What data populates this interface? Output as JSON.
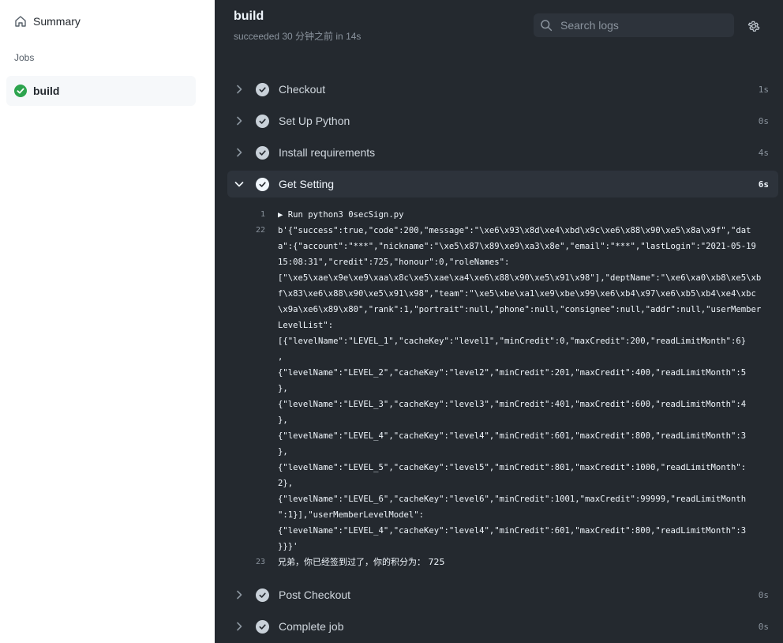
{
  "sidebar": {
    "summary_label": "Summary",
    "jobs_heading": "Jobs",
    "jobs": [
      {
        "label": "build",
        "status": "success"
      }
    ]
  },
  "header": {
    "title": "build",
    "subtitle": "succeeded 30 分钟之前 in 14s",
    "search_placeholder": "Search logs"
  },
  "steps": [
    {
      "name": "Checkout",
      "duration": "1s",
      "expanded": false
    },
    {
      "name": "Set Up Python",
      "duration": "0s",
      "expanded": false
    },
    {
      "name": "Install requirements",
      "duration": "4s",
      "expanded": false
    },
    {
      "name": "Get Setting",
      "duration": "6s",
      "expanded": true
    },
    {
      "name": "Post Checkout",
      "duration": "0s",
      "expanded": false
    },
    {
      "name": "Complete job",
      "duration": "0s",
      "expanded": false
    }
  ],
  "log_lines": [
    {
      "no": "1",
      "text": "▶ Run python3 0secSign.py"
    },
    {
      "no": "22",
      "text": "b'{\"success\":true,\"code\":200,\"message\":\"\\xe6\\x93\\x8d\\xe4\\xbd\\x9c\\xe6\\x88\\x90\\xe5\\x8a\\x9f\",\"data\":{\"account\":\"***\",\"nickname\":\"\\xe5\\x87\\x89\\xe9\\xa3\\x8e\",\"email\":\"***\",\"lastLogin\":\"2021-05-19 15:08:31\",\"credit\":725,\"honour\":0,\"roleNames\":\n[\"\\xe5\\xae\\x9e\\xe9\\xaa\\x8c\\xe5\\xae\\xa4\\xe6\\x88\\x90\\xe5\\x91\\x98\"],\"deptName\":\"\\xe6\\xa0\\xb8\\xe5\\xbf\\x83\\xe6\\x88\\x90\\xe5\\x91\\x98\",\"team\":\"\\xe5\\xbe\\xa1\\xe9\\xbe\\x99\\xe6\\xb4\\x97\\xe6\\xb5\\xb4\\xe4\\xbc\\x9a\\xe6\\x89\\x80\",\"rank\":1,\"portrait\":null,\"phone\":null,\"consignee\":null,\"addr\":null,\"userMemberLevelList\":\n[{\"levelName\":\"LEVEL_1\",\"cacheKey\":\"level1\",\"minCredit\":0,\"maxCredit\":200,\"readLimitMonth\":6}\n,\n{\"levelName\":\"LEVEL_2\",\"cacheKey\":\"level2\",\"minCredit\":201,\"maxCredit\":400,\"readLimitMonth\":5\n},\n{\"levelName\":\"LEVEL_3\",\"cacheKey\":\"level3\",\"minCredit\":401,\"maxCredit\":600,\"readLimitMonth\":4\n},\n{\"levelName\":\"LEVEL_4\",\"cacheKey\":\"level4\",\"minCredit\":601,\"maxCredit\":800,\"readLimitMonth\":3\n},\n{\"levelName\":\"LEVEL_5\",\"cacheKey\":\"level5\",\"minCredit\":801,\"maxCredit\":1000,\"readLimitMonth\":\n2},\n{\"levelName\":\"LEVEL_6\",\"cacheKey\":\"level6\",\"minCredit\":1001,\"maxCredit\":99999,\"readLimitMonth\n\":1}],\"userMemberLevelModel\":\n{\"levelName\":\"LEVEL_4\",\"cacheKey\":\"level4\",\"minCredit\":601,\"maxCredit\":800,\"readLimitMonth\":3\n}}}'"
    },
    {
      "no": "23",
      "text": "兄弟，你已经签到过了，你的积分为： 725"
    }
  ],
  "colors": {
    "success": "#2da44e",
    "main_bg": "#24292f",
    "step_check": "#c9d1d9"
  }
}
